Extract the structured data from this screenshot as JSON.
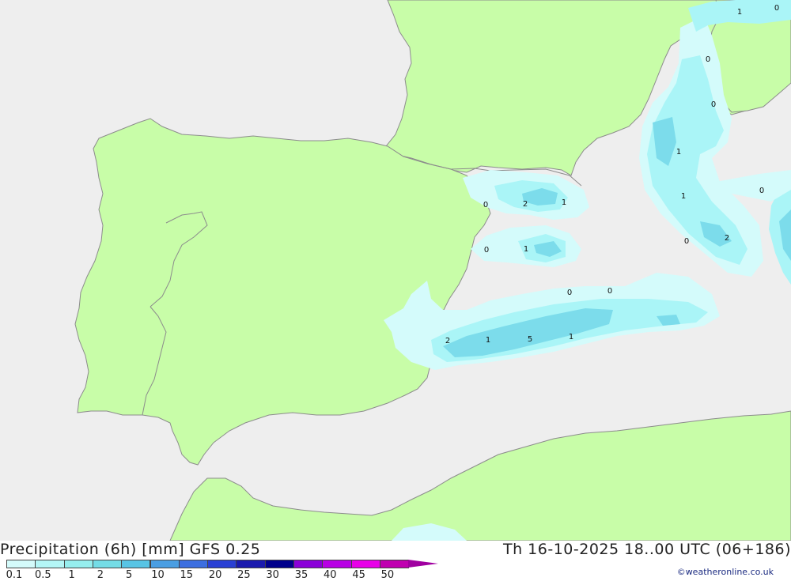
{
  "map": {
    "colors": {
      "sea": "#eeeeee",
      "land": "#c8fda8",
      "border": "#8c8c8c",
      "precip_light": "#d4fbfb",
      "precip_mid": "#aaf5f7",
      "precip_dark": "#7cdceb"
    },
    "contour_labels": [
      "1",
      "0",
      "0",
      "0",
      "1",
      "0",
      "2",
      "1",
      "0",
      "1",
      "1",
      "0",
      "2",
      "0",
      "0",
      "0",
      "2",
      "1",
      "5",
      "1"
    ]
  },
  "footer": {
    "title_left": "Precipitation (6h) [mm] GFS 0.25",
    "title_right": "Th 16-10-2025 18..00 UTC (06+186)",
    "credit": "©weatheronline.co.uk"
  },
  "legend": {
    "labels": [
      "0.1",
      "0.5",
      "1",
      "2",
      "5",
      "10",
      "15",
      "20",
      "25",
      "30",
      "35",
      "40",
      "45",
      "50"
    ],
    "colors": [
      "#d4fbfb",
      "#b4f6f6",
      "#96eeee",
      "#74dce6",
      "#58c4e4",
      "#4a9ee2",
      "#3c6ee0",
      "#2a40d4",
      "#1a1aae",
      "#00008c",
      "#8a00d8",
      "#b800e4",
      "#e800e8",
      "#c000b0",
      "#a000a0"
    ]
  }
}
